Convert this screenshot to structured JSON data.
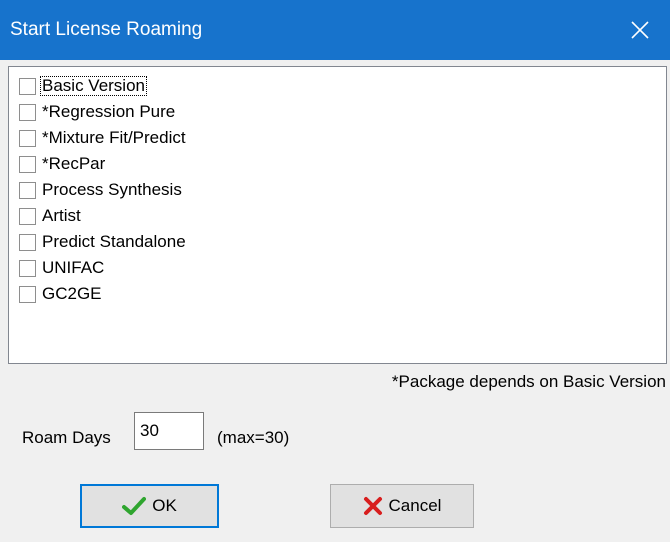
{
  "window": {
    "title": "Start License Roaming",
    "close_icon": "close-icon",
    "title_bar_color": "#1773cc"
  },
  "packages": [
    {
      "label": "Basic Version",
      "checked": false,
      "focused": true
    },
    {
      "label": "*Regression Pure",
      "checked": false
    },
    {
      "label": "*Mixture Fit/Predict",
      "checked": false
    },
    {
      "label": "*RecPar",
      "checked": false
    },
    {
      "label": "Process Synthesis",
      "checked": false
    },
    {
      "label": "Artist",
      "checked": false
    },
    {
      "label": "Predict Standalone",
      "checked": false
    },
    {
      "label": "UNIFAC",
      "checked": false
    },
    {
      "label": "GC2GE",
      "checked": false
    }
  ],
  "footnote": "*Package depends on Basic Version",
  "roam": {
    "label": "Roam Days",
    "value": "30",
    "max_note": "(max=30)"
  },
  "buttons": {
    "ok_label": "OK",
    "ok_icon": "checkmark-icon",
    "cancel_label": "Cancel",
    "cancel_icon": "x-cross-icon"
  }
}
